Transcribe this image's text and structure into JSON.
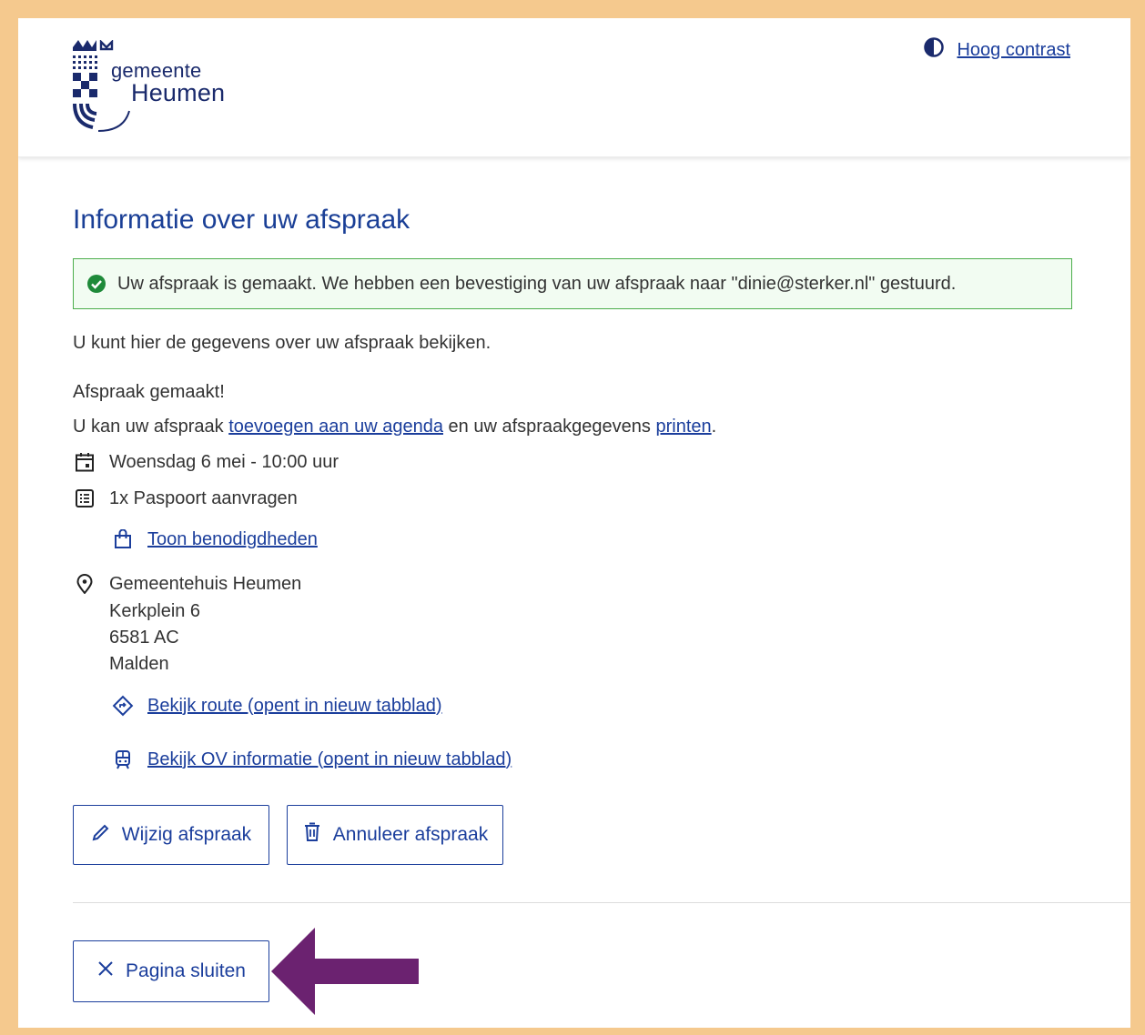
{
  "header": {
    "logo": {
      "line1": "gemeente",
      "line2": "Heumen"
    },
    "contrast_label": "Hoog contrast"
  },
  "main": {
    "title": "Informatie over uw afspraak",
    "alert_text": "Uw afspraak is gemaakt. We hebben een bevestiging van uw afspraak naar \"dinie@sterker.nl\" gestuurd.",
    "intro": "U kunt hier de gegevens over uw afspraak bekijken.",
    "made": "Afspraak gemaakt!",
    "agenda_sentence": {
      "part1": "U kan uw afspraak ",
      "link_agenda": "toevoegen aan uw agenda",
      "part2": " en uw afspraakgegevens ",
      "link_print": "printen",
      "part3": "."
    },
    "datetime": "Woensdag 6 mei - 10:00 uur",
    "product": "1x Paspoort aanvragen",
    "requirements_link": "Toon benodigdheden",
    "location": {
      "name": "Gemeentehuis Heumen",
      "street": "Kerkplein 6",
      "postcode": "6581 AC",
      "city": "Malden"
    },
    "route_link": "Bekijk route (opent in nieuw tabblad)",
    "ov_link": "Bekijk OV informatie (opent in nieuw tabblad)",
    "buttons": {
      "edit": "Wijzig afspraak",
      "cancel": "Annuleer afspraak",
      "close": "Pagina sluiten"
    }
  },
  "colors": {
    "frame": "#f5c98e",
    "heading": "#1a3f96",
    "link": "#1b3e9c",
    "alert_border": "#4cae4c",
    "arrow": "#6b2270"
  },
  "icons": [
    "half-circle-contrast-icon",
    "check-circle-icon",
    "calendar-icon",
    "list-icon",
    "bag-icon",
    "location-pin-icon",
    "route-icon",
    "train-icon",
    "pencil-icon",
    "trash-icon",
    "close-icon",
    "arrow-left-icon"
  ]
}
